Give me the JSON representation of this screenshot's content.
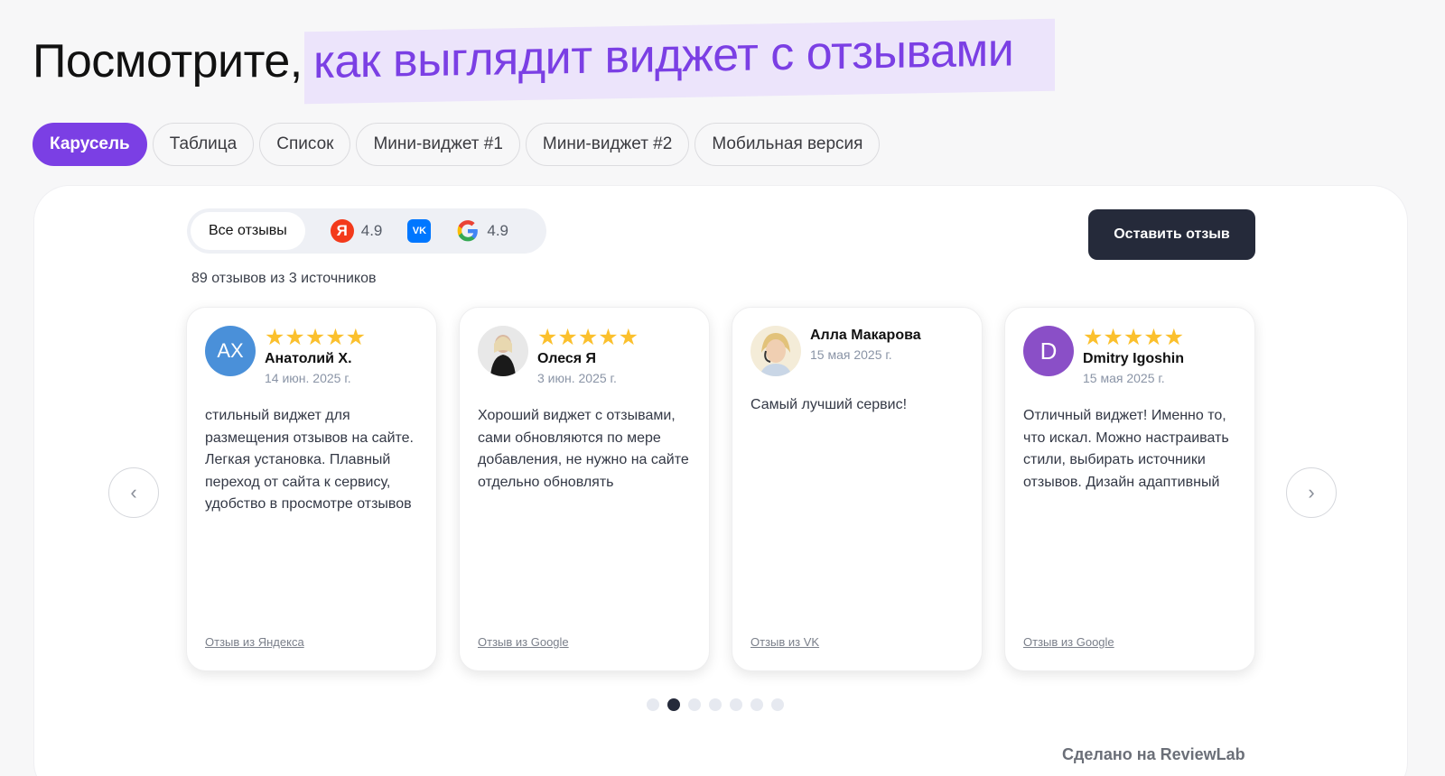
{
  "headline": {
    "plain": "Посмотрите,",
    "accent": "как выглядит виджет с отзывами"
  },
  "tabs": [
    {
      "label": "Карусель",
      "active": true
    },
    {
      "label": "Таблица"
    },
    {
      "label": "Список"
    },
    {
      "label": "Мини-виджет #1"
    },
    {
      "label": "Мини-виджет #2"
    },
    {
      "label": "Мобильная версия"
    }
  ],
  "filter": {
    "all_label": "Все отзывы",
    "yandex": {
      "icon": "yandex-icon",
      "letter": "Я",
      "rating": "4.9"
    },
    "vk": {
      "icon": "vk-icon",
      "letter": "VK"
    },
    "google": {
      "icon": "google-icon",
      "rating": "4.9"
    }
  },
  "count_text": "89 отзывов из 3 источников",
  "leave_review_label": "Оставить отзыв",
  "reviews": [
    {
      "initials": "АХ",
      "avatar_color": "#4a90d9",
      "name": "Анатолий Х.",
      "date": "14 июн. 2025 г.",
      "stars": "★★★★★",
      "text": "стильный виджет для размещения отзывов на сайте. Легкая установка. Плавный переход от сайта к сервису, удобство в просмотре отзывов",
      "source": "Отзыв из Яндекса"
    },
    {
      "initials": "",
      "avatar_color": "#d9d9d9",
      "name": "Олеся Я",
      "date": "3 июн. 2025 г.",
      "stars": "★★★★★",
      "text": "Хороший виджет с отзывами, сами обновляются по мере добавления, не нужно на сайте отдельно обновлять",
      "source": "Отзыв из Google"
    },
    {
      "initials": "",
      "avatar_color": "#f3e6c8",
      "name": "Алла Макарова",
      "date": "15 мая 2025 г.",
      "stars": "",
      "text": "Самый лучший сервис!",
      "source": "Отзыв из VK"
    },
    {
      "initials": "D",
      "avatar_color": "#8a4fc7",
      "name": "Dmitry Igoshin",
      "date": "15 мая 2025 г.",
      "stars": "★★★★★",
      "text": "Отличный виджет! Именно то, что искал. Можно настраивать стили, выбирать источники отзывов. Дизайн адаптивный",
      "source": "Отзыв из Google"
    }
  ],
  "carousel": {
    "prev_icon": "chevron-left-icon",
    "next_icon": "chevron-right-icon",
    "pages": 7,
    "active_page": 2
  },
  "made_with": "Сделано на ReviewLab",
  "colors": {
    "accent": "#7b3fe4",
    "accent_bg": "#ece4fb",
    "dark": "#252a3a",
    "star": "#fbc02d"
  }
}
